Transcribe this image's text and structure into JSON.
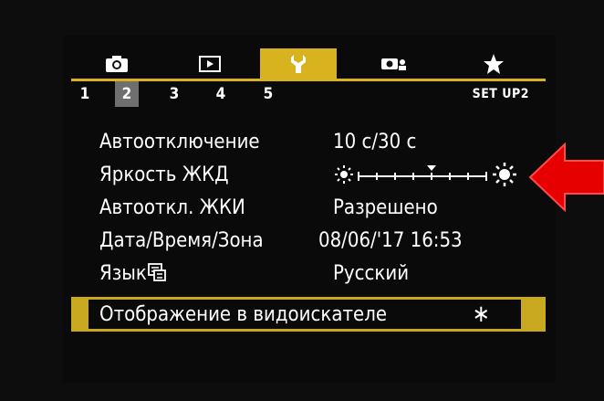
{
  "tabs": [
    {
      "icon": "camera-icon",
      "active": false
    },
    {
      "icon": "playback-icon",
      "active": false
    },
    {
      "icon": "wrench-icon",
      "active": true
    },
    {
      "icon": "custom-function-icon",
      "active": false
    },
    {
      "icon": "star-icon",
      "active": false
    }
  ],
  "subtabs": [
    "1",
    "2",
    "3",
    "4",
    "5"
  ],
  "active_subtab": "2",
  "setup_label": "SET UP2",
  "menu": {
    "items": [
      {
        "label": "Автоотключение",
        "value": "10 с/30 с"
      },
      {
        "label": "Яркость ЖКД",
        "value": ""
      },
      {
        "label": "Автооткл. ЖКИ",
        "value": "Разрешено"
      },
      {
        "label": "Дата/Время/Зона",
        "value": "08/06/'17 16:53"
      },
      {
        "label": "Язык",
        "value": "Русский"
      }
    ],
    "selected": {
      "label": "Отображение в видоискателе",
      "value": "∗"
    }
  },
  "lcd_brightness": {
    "level": 4,
    "max": 7
  },
  "colors": {
    "accent": "#d8b21f",
    "arrow": "#e60000",
    "text": "#ffffff",
    "background": "#0a0a0a"
  }
}
